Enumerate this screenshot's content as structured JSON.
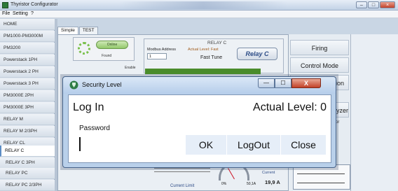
{
  "app": {
    "title": "Thyristor Configurator"
  },
  "menu": {
    "file": "File",
    "setting": "Setting",
    "help": "?"
  },
  "sidebar": {
    "items": [
      {
        "label": "HOME"
      },
      {
        "label": "PM1000-PM3000M"
      },
      {
        "label": "PM3200"
      },
      {
        "label": "Powerstack 1PH"
      },
      {
        "label": "Powerstack 2 PH"
      },
      {
        "label": "Powerstack 3 PH"
      },
      {
        "label": "PM3000E 2PH"
      },
      {
        "label": "PM3000E 3PH"
      },
      {
        "label": "RELAY M"
      },
      {
        "label": "RELAY M 2/3PH"
      },
      {
        "label": "RELAY CL"
      },
      {
        "label": "RELAY C"
      },
      {
        "label": "RELAY C 3PH"
      },
      {
        "label": "RELAY PC"
      },
      {
        "label": "RELAY PC 2/3PH"
      }
    ],
    "active_index": 11
  },
  "tabs": [
    {
      "label": "Simple"
    },
    {
      "label": "TEST"
    }
  ],
  "device": {
    "online_label": "Online",
    "found_label": "Found",
    "enable_label": "Enable",
    "relay_title": "RELAY C",
    "modbus_label": "Modbus Address",
    "modbus_value": "1",
    "actual_level_label": "Actual Level: Fast",
    "fast_tune": "Fast Tune",
    "logo": "Relay C"
  },
  "right_menu": {
    "firing": "Firing",
    "control_mode": "Control Mode",
    "partial_tion": "tion",
    "partial_analyzer": "alyzer",
    "monitor": "itor"
  },
  "gauge": {
    "label": "Current",
    "value": "19,9",
    "unit": "A",
    "min": "0%",
    "max": "50,1A",
    "current_limit": "Current Limit"
  },
  "dialog": {
    "title": "Security Level",
    "login_label": "Log In",
    "actual_level": "Actual Level: 0",
    "password_label": "Password",
    "password_value": "",
    "ok_label": "OK",
    "logout_label": "LogOut",
    "close_label": "Close",
    "min_glyph": "—",
    "max_glyph": "☐",
    "close_glyph": "X"
  }
}
